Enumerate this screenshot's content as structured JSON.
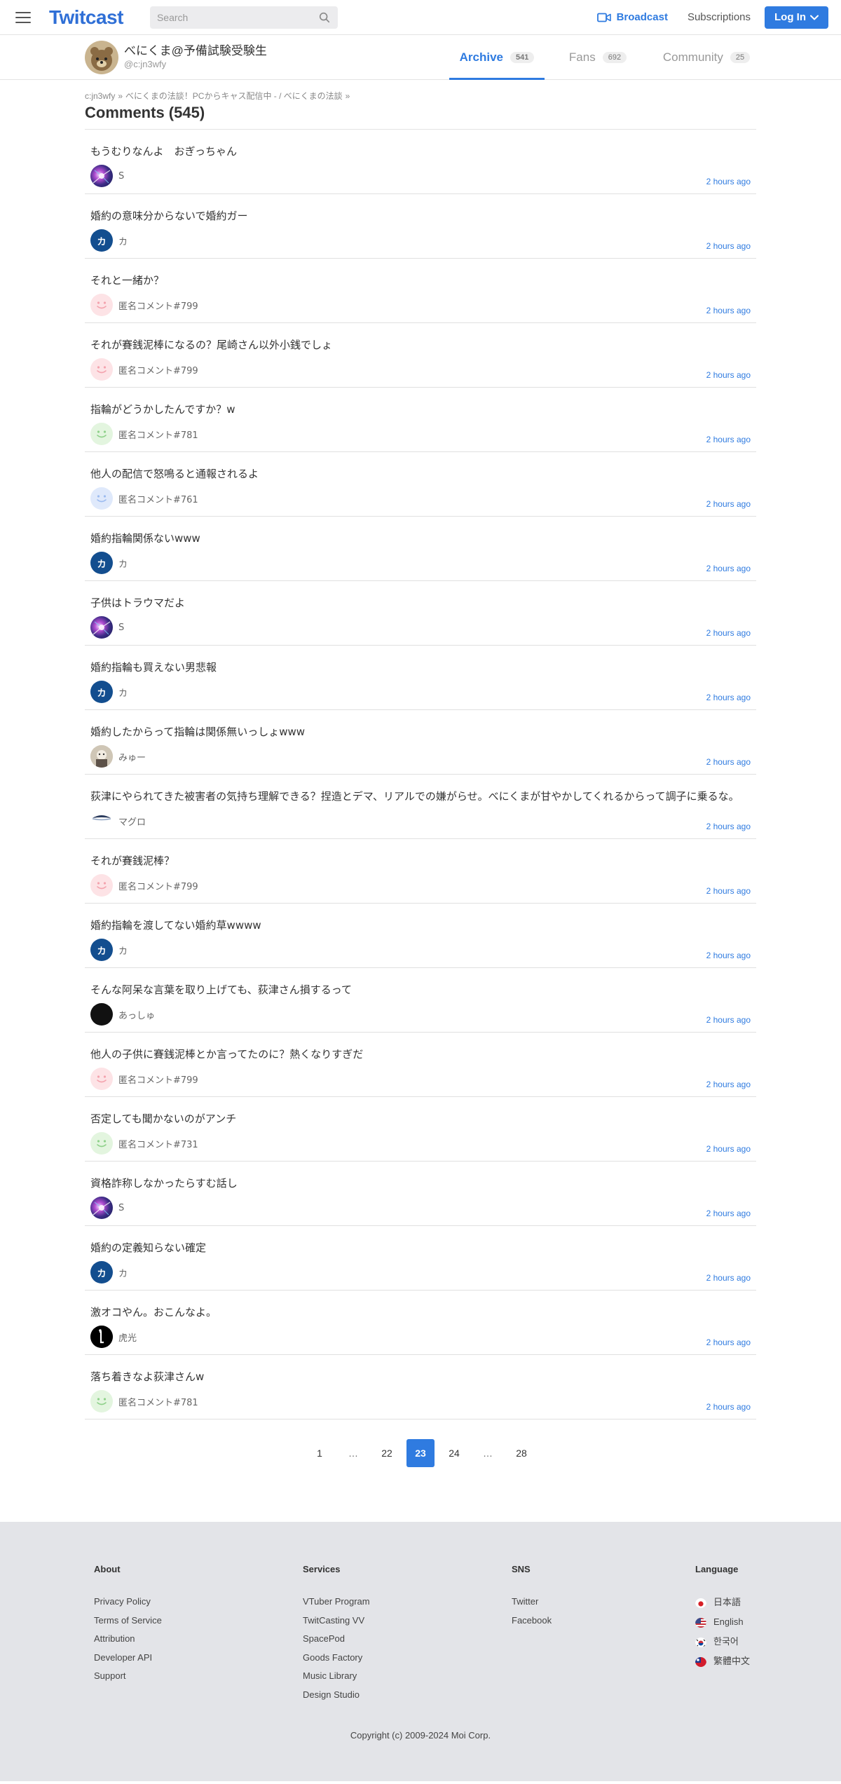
{
  "header": {
    "logo": "Twitcast",
    "search_placeholder": "Search",
    "broadcast": "Broadcast",
    "subscriptions": "Subscriptions",
    "login": "Log In"
  },
  "user": {
    "name": "べにくま@予備試験受験生",
    "id": "@c:jn3wfy"
  },
  "tabs": [
    {
      "label": "Archive",
      "count": "541"
    },
    {
      "label": "Fans",
      "count": "692"
    },
    {
      "label": "Community",
      "count": "25"
    }
  ],
  "breadcrumb": {
    "user": "c:jn3wfy",
    "movie": "べにくまの法談！PCからキャス配信中 - / べにくまの法談"
  },
  "heading": "Comments (545)",
  "comments": [
    {
      "text": "もうむりなんよ　おぎっちゃん",
      "name": "S",
      "avatar": "cosmic",
      "time": "2 hours ago"
    },
    {
      "text": "婚約の意味分からないで婚約ガー",
      "name": "カ",
      "avatar": "ka",
      "time": "2 hours ago"
    },
    {
      "text": "それと一緒か？",
      "name": "匿名コメント#799",
      "avatar": "pink",
      "time": "2 hours ago"
    },
    {
      "text": "それが賽銭泥棒になるの？尾崎さん以外小銭でしょ",
      "name": "匿名コメント#799",
      "avatar": "pink",
      "time": "2 hours ago"
    },
    {
      "text": "指輪がどうかしたんですか？w",
      "name": "匿名コメント#781",
      "avatar": "green",
      "time": "2 hours ago"
    },
    {
      "text": "他人の配信で怒鳴ると通報されるよ",
      "name": "匿名コメント#761",
      "avatar": "blue",
      "time": "2 hours ago"
    },
    {
      "text": "婚約指輪関係ないwww",
      "name": "カ",
      "avatar": "ka",
      "time": "2 hours ago"
    },
    {
      "text": "子供はトラウマだよ",
      "name": "S",
      "avatar": "cosmic",
      "time": "2 hours ago"
    },
    {
      "text": "婚約指輪も買えない男悲報",
      "name": "カ",
      "avatar": "ka",
      "time": "2 hours ago"
    },
    {
      "text": "婚約したからって指輪は関係無いっしょwww",
      "name": "みゅー",
      "avatar": "photo",
      "time": "2 hours ago"
    },
    {
      "text": "荻津にやられてきた被害者の気持ち理解できる？捏造とデマ、リアルでの嫌がらせ。べにくまが甘やかしてくれるからって調子に乗るな。",
      "name": "マグロ",
      "avatar": "fish",
      "time": "2 hours ago"
    },
    {
      "text": "それが賽銭泥棒？",
      "name": "匿名コメント#799",
      "avatar": "pink",
      "time": "2 hours ago"
    },
    {
      "text": "婚約指輪を渡してない婚約草wwww",
      "name": "カ",
      "avatar": "ka",
      "time": "2 hours ago"
    },
    {
      "text": "そんな阿呆な言葉を取り上げても、荻津さん損するって",
      "name": "あっしゅ",
      "avatar": "black",
      "time": "2 hours ago"
    },
    {
      "text": "他人の子供に賽銭泥棒とか言ってたのに？熱くなりすぎだ",
      "name": "匿名コメント#799",
      "avatar": "pink",
      "time": "2 hours ago"
    },
    {
      "text": "否定しても聞かないのがアンチ",
      "name": "匿名コメント#731",
      "avatar": "green",
      "time": "2 hours ago"
    },
    {
      "text": "資格詐称しなかったらすむ話し",
      "name": "S",
      "avatar": "cosmic",
      "time": "2 hours ago"
    },
    {
      "text": "婚約の定義知らない確定",
      "name": "カ",
      "avatar": "ka",
      "time": "2 hours ago"
    },
    {
      "text": "激オコやん。おこんなよ。",
      "name": "虎光",
      "avatar": "tiger",
      "time": "2 hours ago"
    },
    {
      "text": "落ち着きなよ荻津さんw",
      "name": "匿名コメント#781",
      "avatar": "green",
      "time": "2 hours ago"
    }
  ],
  "pagination": [
    "1",
    "…",
    "22",
    "23",
    "24",
    "…",
    "28"
  ],
  "pagination_current": "23",
  "footer": {
    "about": {
      "title": "About",
      "links": [
        "Privacy Policy",
        "Terms of Service",
        "Attribution",
        "Developer API",
        "Support"
      ]
    },
    "services": {
      "title": "Services",
      "links": [
        "VTuber Program",
        "TwitCasting VV",
        "SpacePod",
        "Goods Factory",
        "Music Library",
        "Design Studio"
      ]
    },
    "sns": {
      "title": "SNS",
      "links": [
        "Twitter",
        "Facebook"
      ]
    },
    "language": {
      "title": "Language",
      "links": [
        "日本語",
        "English",
        "한국어",
        "繁體中文"
      ]
    },
    "copyright": "Copyright (c) 2009-2024 Moi Corp."
  },
  "colors": {
    "accent": "#2f7be0",
    "logo": "#2f6fd6",
    "footer_bg": "#e3e4e8"
  }
}
